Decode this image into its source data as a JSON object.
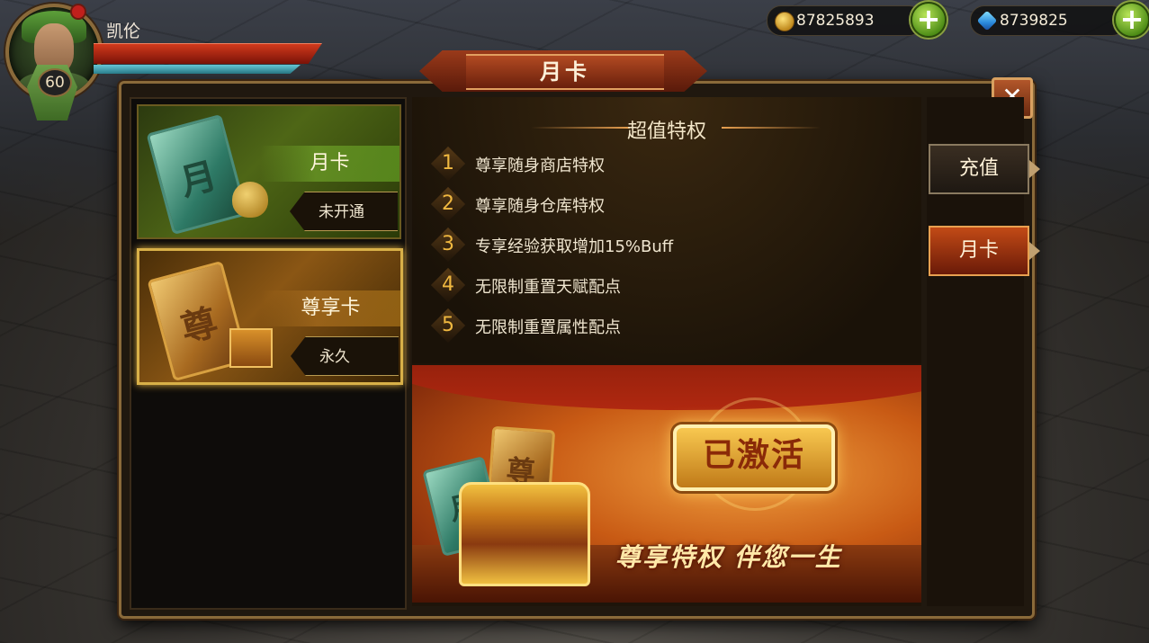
{
  "player": {
    "name": "凯伦",
    "level": "60",
    "hp_level": 0.95,
    "mp_level": 0.9
  },
  "currency": {
    "gold": "87825893",
    "diamonds": "8739825"
  },
  "dialog": {
    "title": "月卡",
    "close_label": "✕"
  },
  "cards": [
    {
      "icon_char": "月",
      "label": "月卡",
      "status": "未开通"
    },
    {
      "icon_char": "尊",
      "label": "尊享卡",
      "status": "永久"
    }
  ],
  "privileges": {
    "title": "超值特权",
    "items": [
      {
        "num": "1",
        "text": "尊享随身商店特权"
      },
      {
        "num": "2",
        "text": "尊享随身仓库特权"
      },
      {
        "num": "3",
        "text": "专享经验获取增加15%Buff"
      },
      {
        "num": "4",
        "text": "无限制重置天赋配点"
      },
      {
        "num": "5",
        "text": "无限制重置属性配点"
      }
    ]
  },
  "banner": {
    "card_char_1": "月",
    "card_char_2": "尊",
    "stamp": "已激活",
    "slogan": "尊享特权  伴您一生"
  },
  "tabs": [
    {
      "label": "充值"
    },
    {
      "label": "月卡"
    }
  ],
  "colors": {
    "frame_border": "#8a6a3a",
    "accent_gold": "#f0b840",
    "active_tab": "#c24a16"
  }
}
